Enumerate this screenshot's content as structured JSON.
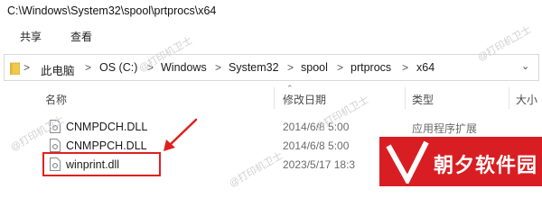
{
  "window": {
    "path": "C:\\Windows\\System32\\spool\\prtprocs\\x64"
  },
  "ribbon": {
    "tabs": [
      "共享",
      "查看"
    ]
  },
  "address": {
    "crumbs": [
      "此电脑",
      "OS (C:)",
      "Windows",
      "System32",
      "spool",
      "prtprocs",
      "x64"
    ],
    "separator": ">"
  },
  "columns": {
    "name": "名称",
    "modified": "修改日期",
    "type": "类型",
    "size": "大小"
  },
  "files": [
    {
      "name": "CNMPDCH.DLL",
      "modified": "2014/6/8 5:00",
      "type": "应用程序扩展"
    },
    {
      "name": "CNMPPCH.DLL",
      "modified": "2014/6/8 5:00",
      "type": "应用程序扩展"
    },
    {
      "name": "winprint.dll",
      "modified": "2023/5/17 18:3",
      "type": ""
    }
  ],
  "watermark": {
    "text": "@打印机卫士"
  },
  "logo": {
    "text": "朝夕软件园"
  },
  "colors": {
    "highlight": "#e0201d",
    "logo_bg": "#d81e22",
    "folder": "#f2c94c"
  }
}
